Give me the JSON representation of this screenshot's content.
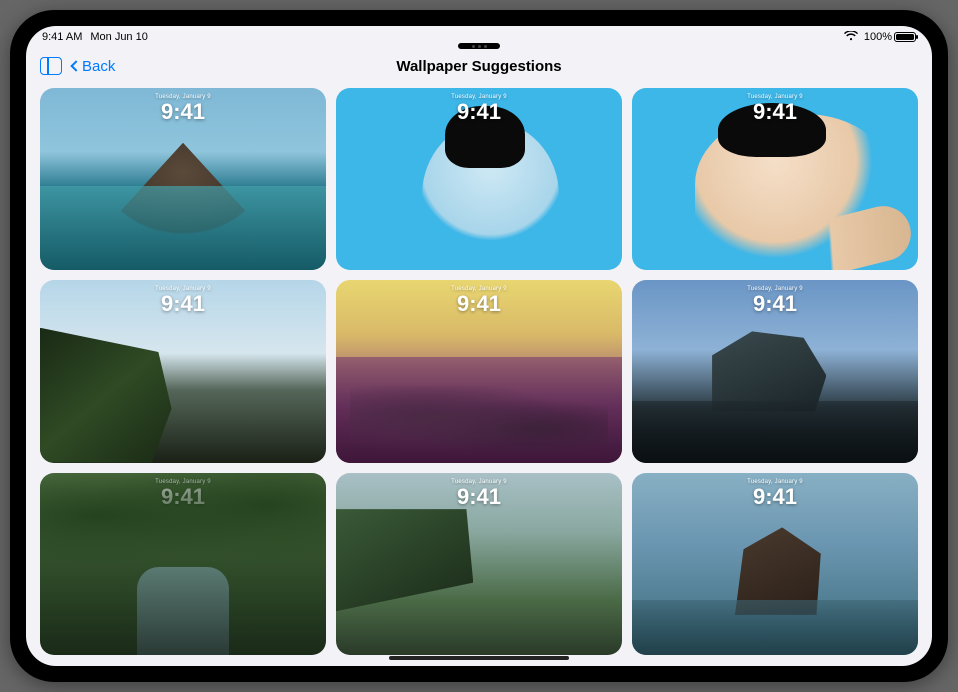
{
  "status": {
    "time": "9:41 AM",
    "date": "Mon Jun 10",
    "battery_pct": "100%"
  },
  "nav": {
    "back_label": "Back",
    "title": "Wallpaper Suggestions"
  },
  "tile_overlay": {
    "date": "Tuesday, January 9",
    "time": "9:41"
  },
  "tiles": [
    {
      "id": "volcano-lagoon",
      "scene": "scene-1"
    },
    {
      "id": "portrait-blue-duotone",
      "scene": "scene-2"
    },
    {
      "id": "portrait-selfie-blue",
      "scene": "scene-3"
    },
    {
      "id": "cliff-greenery",
      "scene": "scene-4"
    },
    {
      "id": "rocky-beach-duotone",
      "scene": "scene-5"
    },
    {
      "id": "sea-stack-dark",
      "scene": "scene-6"
    },
    {
      "id": "jungle-stream",
      "scene": "scene-7"
    },
    {
      "id": "highland-plateau",
      "scene": "scene-8"
    },
    {
      "id": "ocean-rock",
      "scene": "scene-9"
    }
  ]
}
